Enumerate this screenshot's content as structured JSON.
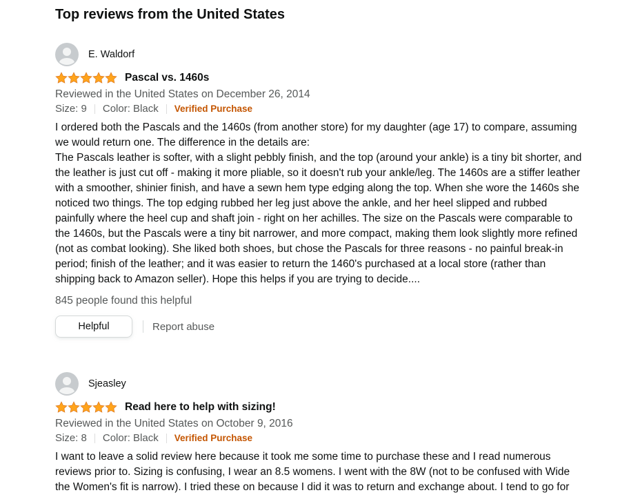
{
  "section": {
    "title": "Top reviews from the United States"
  },
  "colors": {
    "star": "#ffa41c",
    "verified": "#c45500",
    "muted": "#565959"
  },
  "reviews": [
    {
      "author": "E. Waldorf",
      "rating": 5,
      "title": "Pascal vs. 1460s",
      "date": "Reviewed in the United States on December 26, 2014",
      "size": "Size: 9",
      "color": "Color: Black",
      "verified": "Verified Purchase",
      "body": [
        "I ordered both the Pascals and the 1460s (from another store) for my daughter (age 17) to compare, assuming we would return one. The difference in the details are:",
        "The Pascals leather is softer, with a slight pebbly finish, and the top (around your ankle) is a tiny bit shorter, and the leather is just cut off - making it more pliable, so it doesn't rub your ankle/leg. The 1460s are a stiffer leather with a smoother, shinier finish, and have a sewn hem type edging along the top. When she wore the 1460s she noticed two things. The top edging rubbed her leg just above the ankle, and her heel slipped and rubbed painfully where the heel cup and shaft join - right on her achilles. The size on the Pascals were comparable to the 1460s, but the Pascals were a tiny bit narrower, and more compact, making them look slightly more refined (not as combat looking). She liked both shoes, but chose the Pascals for three reasons - no painful break-in period; finish of the leather; and it was easier to return the 1460's purchased at a local store (rather than shipping back to Amazon seller). Hope this helps if you are trying to decide...."
      ],
      "helpful_count": "845 people found this helpful",
      "helpful_label": "Helpful",
      "report_label": "Report abuse"
    },
    {
      "author": "Sjeasley",
      "rating": 5,
      "title": "Read here to help with sizing!",
      "date": "Reviewed in the United States on October 9, 2016",
      "size": "Size: 8",
      "color": "Color: Black",
      "verified": "Verified Purchase",
      "body": [
        "I want to leave a solid review here because it took me some time to purchase these and I read numerous reviews prior to. Sizing is confusing, I wear an 8.5 womens. I went with the 8W (not to be confused with Wide the Women's fit is narrow). I tried these on because I did it was to return and exchange about. I tend to go for"
      ]
    }
  ]
}
